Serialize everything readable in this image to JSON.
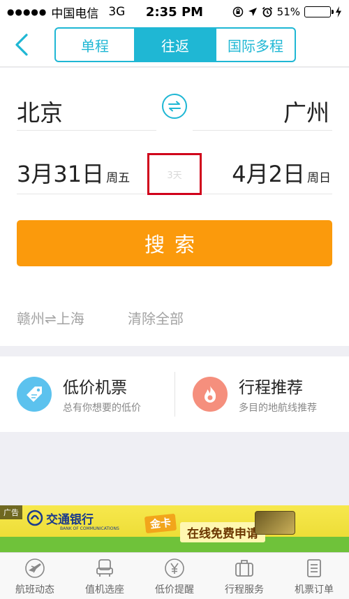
{
  "status": {
    "carrier": "中国电信",
    "network": "3G",
    "time": "2:35 PM",
    "battery": "51%",
    "battery_level": 0.51
  },
  "nav": {
    "tabs": [
      {
        "label": "单程",
        "active": false
      },
      {
        "label": "往返",
        "active": true
      },
      {
        "label": "国际多程",
        "active": false
      }
    ]
  },
  "form": {
    "from_city": "北京",
    "to_city": "广州",
    "depart_date": "3月31日",
    "depart_weekday": "周五",
    "return_date": "4月2日",
    "return_weekday": "周日",
    "duration": "3天",
    "search_label": "搜索"
  },
  "history": {
    "recent_route": "赣州⇌上海",
    "clear_all": "清除全部"
  },
  "promo": {
    "items": [
      {
        "title": "低价机票",
        "subtitle": "总有你想要的低价",
        "icon": "price-tag-icon",
        "color": "#5cc2ee"
      },
      {
        "title": "行程推荐",
        "subtitle": "多目的地航线推荐",
        "icon": "flame-icon",
        "color": "#f58f7d"
      }
    ]
  },
  "ad": {
    "tag": "广告",
    "bank_name": "交通银行",
    "bank_name_en": "BANK OF COMMUNICATIONS",
    "card": "金卡",
    "apply": "在线免费申请"
  },
  "tabbar": {
    "items": [
      {
        "label": "航班动态",
        "icon": "plane-icon"
      },
      {
        "label": "值机选座",
        "icon": "seat-icon"
      },
      {
        "label": "低价提醒",
        "icon": "yen-icon"
      },
      {
        "label": "行程服务",
        "icon": "luggage-icon"
      },
      {
        "label": "机票订单",
        "icon": "order-icon"
      }
    ]
  },
  "colors": {
    "accent": "#1fb7d4",
    "search": "#fb9a0c",
    "highlight_border": "#d0021b"
  }
}
